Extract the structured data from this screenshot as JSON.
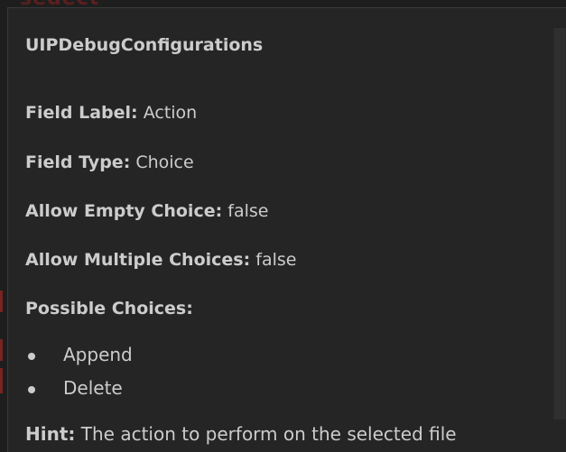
{
  "background": {
    "fragment_text": "sedect"
  },
  "hover": {
    "title": "UIPDebugConfigurations",
    "fields": [
      {
        "label": "Field Label",
        "value": "Action"
      },
      {
        "label": "Field Type",
        "value": "Choice"
      },
      {
        "label": "Allow Empty Choice",
        "value": "false"
      },
      {
        "label": "Allow Multiple Choices",
        "value": "false"
      },
      {
        "label": "Possible Choices",
        "value": ""
      }
    ],
    "choices": [
      "Append",
      "Delete"
    ],
    "hint_label": "Hint",
    "hint_text": "The action to perform on the selected file"
  },
  "colors": {
    "editor_background": "#1e1e1e",
    "hover_background": "#252526",
    "text": "#cccccc",
    "gutter_marker": "#7a2323"
  }
}
